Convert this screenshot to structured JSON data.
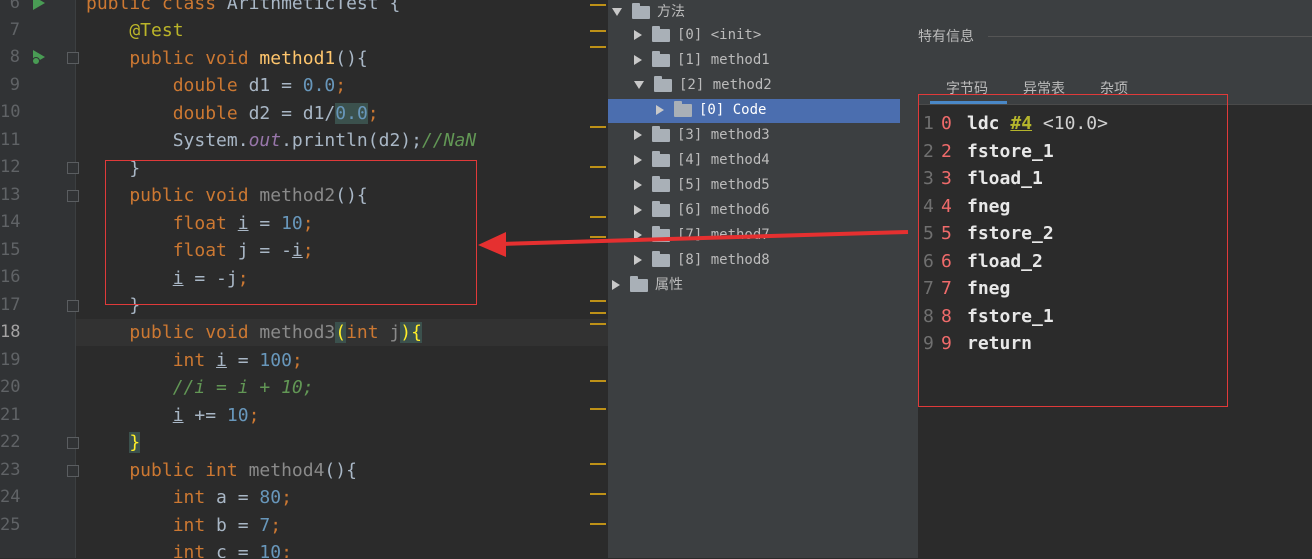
{
  "editor": {
    "line_numbers": [
      "6",
      "7",
      "8",
      "9",
      "10",
      "11",
      "12",
      "13",
      "14",
      "15",
      "16",
      "17",
      "18",
      "19",
      "20",
      "21",
      "22",
      "23",
      "24",
      "25"
    ],
    "lines": [
      [
        {
          "t": "public class ",
          "c": "kw"
        },
        {
          "t": "ArithmeticTest {",
          "c": ""
        }
      ],
      [
        {
          "t": "    @Test",
          "c": "ann"
        }
      ],
      [
        {
          "t": "    public void ",
          "c": "kw"
        },
        {
          "t": "method1",
          "c": "fn"
        },
        {
          "t": "(){",
          "c": ""
        }
      ],
      [
        {
          "t": "        double ",
          "c": "kw"
        },
        {
          "t": "d1 = ",
          "c": ""
        },
        {
          "t": "0.0",
          "c": "num"
        },
        {
          "t": ";",
          "c": "kw"
        }
      ],
      [
        {
          "t": "        double ",
          "c": "kw"
        },
        {
          "t": "d2 = d1/",
          "c": ""
        },
        {
          "t": "0.0",
          "c": "num hlbox"
        },
        {
          "t": ";",
          "c": "kw"
        }
      ],
      [
        {
          "t": "        System.",
          "c": ""
        },
        {
          "t": "out",
          "c": "out"
        },
        {
          "t": ".println(d2);",
          "c": ""
        },
        {
          "t": "//NaN",
          "c": "cmt"
        }
      ],
      [
        {
          "t": "    }",
          "c": ""
        }
      ],
      [
        {
          "t": "    public void ",
          "c": "kw"
        },
        {
          "t": "method2",
          "c": "gray"
        },
        {
          "t": "(){",
          "c": ""
        }
      ],
      [
        {
          "t": "        float ",
          "c": "kw"
        },
        {
          "t": "i",
          "c": "uline"
        },
        {
          "t": " = ",
          "c": ""
        },
        {
          "t": "10",
          "c": "num"
        },
        {
          "t": ";",
          "c": "kw"
        }
      ],
      [
        {
          "t": "        float ",
          "c": "kw"
        },
        {
          "t": "j = -",
          "c": ""
        },
        {
          "t": "i",
          "c": "uline"
        },
        {
          "t": ";",
          "c": "kw"
        }
      ],
      [
        {
          "t": "        ",
          "c": ""
        },
        {
          "t": "i",
          "c": "uline"
        },
        {
          "t": " = -j",
          "c": ""
        },
        {
          "t": ";",
          "c": "kw"
        }
      ],
      [
        {
          "t": "    }",
          "c": ""
        }
      ],
      [
        {
          "t": "    public void ",
          "c": "kw"
        },
        {
          "t": "method3",
          "c": "gray"
        },
        {
          "t": "(",
          "c": "brace-hl"
        },
        {
          "t": "int ",
          "c": "kw"
        },
        {
          "t": "j",
          "c": "gray"
        },
        {
          "t": ")",
          "c": "brace-hl"
        },
        {
          "t": "{",
          "c": "brace-hl"
        }
      ],
      [
        {
          "t": "        int ",
          "c": "kw"
        },
        {
          "t": "i",
          "c": "uline"
        },
        {
          "t": " = ",
          "c": ""
        },
        {
          "t": "100",
          "c": "num"
        },
        {
          "t": ";",
          "c": "kw"
        }
      ],
      [
        {
          "t": "        //i = i + 10;",
          "c": "cmt"
        }
      ],
      [
        {
          "t": "        ",
          "c": ""
        },
        {
          "t": "i",
          "c": "uline"
        },
        {
          "t": " += ",
          "c": ""
        },
        {
          "t": "10",
          "c": "num"
        },
        {
          "t": ";",
          "c": "kw"
        }
      ],
      [
        {
          "t": "    ",
          "c": ""
        },
        {
          "t": "}",
          "c": "brace-hl"
        }
      ],
      [
        {
          "t": "    public int ",
          "c": "kw"
        },
        {
          "t": "method4",
          "c": "gray"
        },
        {
          "t": "(){",
          "c": ""
        }
      ],
      [
        {
          "t": "        int ",
          "c": "kw"
        },
        {
          "t": "a = ",
          "c": ""
        },
        {
          "t": "80",
          "c": "num"
        },
        {
          "t": ";",
          "c": "kw"
        }
      ],
      [
        {
          "t": "        int ",
          "c": "kw"
        },
        {
          "t": "b = ",
          "c": ""
        },
        {
          "t": "7",
          "c": "num"
        },
        {
          "t": ";",
          "c": "kw"
        }
      ],
      [
        {
          "t": "        int ",
          "c": "kw"
        },
        {
          "t": "c = ",
          "c": ""
        },
        {
          "t": "10",
          "c": "num"
        },
        {
          "t": ";",
          "c": "kw"
        }
      ]
    ]
  },
  "tree": {
    "methods_label": "方法",
    "items": [
      {
        "label": "[0] <init>"
      },
      {
        "label": "[1] method1"
      },
      {
        "label": "[2] method2"
      },
      {
        "label": "[0] Code"
      },
      {
        "label": "[3] method3"
      },
      {
        "label": "[4] method4"
      },
      {
        "label": "[5] method5"
      },
      {
        "label": "[6] method6"
      },
      {
        "label": "[7] method7"
      },
      {
        "label": "[8] method8"
      }
    ],
    "attributes_label": "属性"
  },
  "info": {
    "title": "特有信息",
    "tabs": [
      "字节码",
      "异常表",
      "杂项"
    ],
    "bytecode": [
      {
        "idx": "1",
        "off": "0",
        "op": "ldc",
        "ref": "#4",
        "arg": "<10.0>"
      },
      {
        "idx": "2",
        "off": "2",
        "op": "fstore_1",
        "ref": "",
        "arg": ""
      },
      {
        "idx": "3",
        "off": "3",
        "op": "fload_1",
        "ref": "",
        "arg": ""
      },
      {
        "idx": "4",
        "off": "4",
        "op": "fneg",
        "ref": "",
        "arg": ""
      },
      {
        "idx": "5",
        "off": "5",
        "op": "fstore_2",
        "ref": "",
        "arg": ""
      },
      {
        "idx": "6",
        "off": "6",
        "op": "fload_2",
        "ref": "",
        "arg": ""
      },
      {
        "idx": "7",
        "off": "7",
        "op": "fneg",
        "ref": "",
        "arg": ""
      },
      {
        "idx": "8",
        "off": "8",
        "op": "fstore_1",
        "ref": "",
        "arg": ""
      },
      {
        "idx": "9",
        "off": "9",
        "op": "return",
        "ref": "",
        "arg": ""
      }
    ]
  },
  "colors": {
    "highlight_box": "#e03a3a",
    "selection": "#4b6eaf",
    "keyword": "#cc7832",
    "function": "#ffc66d",
    "number": "#6897bb"
  }
}
